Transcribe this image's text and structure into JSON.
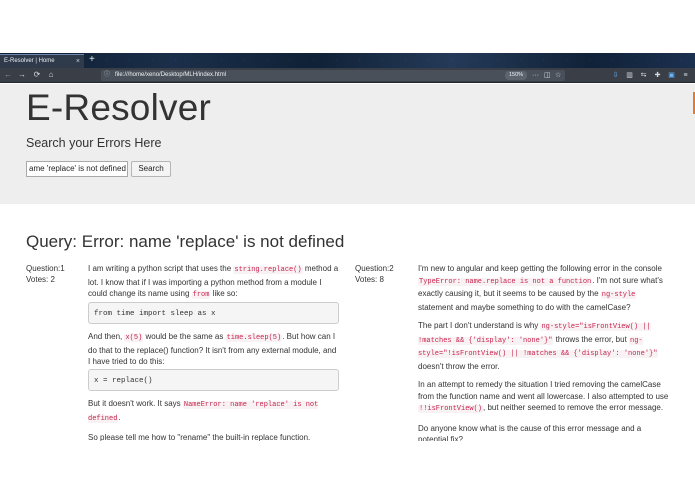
{
  "browser": {
    "tab_title": "E-Resolver | Home",
    "tab_close": "×",
    "new_tab": "+",
    "nav_back": "←",
    "nav_forward": "→",
    "nav_reload": "⟳",
    "nav_home": "⌂",
    "url_info_icon": "ⓘ",
    "url": "file:///home/xeno/Desktop/MLH/index.html",
    "zoom": "150%",
    "url_more": "···",
    "url_pocket": "◫",
    "url_bookmark": "☆",
    "toolbar_icons": [
      "download-icon",
      "library-icon",
      "sync-icon",
      "extension-icon",
      "sidebar-icon",
      "screenshot-icon",
      "account-icon",
      "menu-icon"
    ],
    "toolbar_glyphs": [
      "⇩",
      "▥",
      "⇆",
      "✚",
      "▣",
      "◉",
      "☺",
      "≡"
    ]
  },
  "header": {
    "brand": "E-Resolver",
    "subtitle": "Search your Errors Here",
    "search_value": "ame 'replace' is not defined",
    "search_button": "Search"
  },
  "query": {
    "title": "Query: Error: name 'replace' is not defined"
  },
  "questions": [
    {
      "label": "Question:1",
      "votes": "Votes: 2",
      "p1": [
        "I am writing a python script that uses the ",
        "string.replace()",
        " method a lot. I know that if I was importing a python method from a module I could change its name using ",
        "from",
        " like so:"
      ],
      "code1": "from time import sleep as x",
      "p2": [
        "And then, ",
        "x(5)",
        " would be the same as ",
        "time.sleep(5)",
        ". But how can I do that to the replace() function? It isn't from any external module, and I have tried to do this:"
      ],
      "code2": "x = replace()",
      "p3": [
        "But it doesn't work. It says ",
        "NameError: name 'replace' is not defined",
        "."
      ],
      "p4": "So please tell me how to \"rename\" the built-in replace function."
    },
    {
      "label": "Question:2",
      "votes": "Votes: 8",
      "p1": [
        "I'm new to angular and keep getting the following error in the console ",
        "TypeError: name.replace is not a function",
        ". I'm not sure what's exactly causing it, but it seems to be caused by the ",
        "ng-style",
        " statement and maybe something to do with the camelCase?"
      ],
      "p2": [
        "The part I don't understand is why ",
        "ng-style=\"isFrontView() || !matches && {'display': 'none'}\"",
        " throws the error, but ",
        "ng-style=\"!isFrontView() || !matches && {'display': 'none'}\"",
        " doesn't throw the error."
      ],
      "p3": [
        "In an attempt to remedy the situation I tried removing the camelCase from the function name and went all lowercase. I also attempted to use ",
        "!!isFrontView()",
        ", but neither seemed to remove the error message."
      ],
      "p4": "Do anyone know what is the cause of this error message and a potential fix?"
    }
  ]
}
